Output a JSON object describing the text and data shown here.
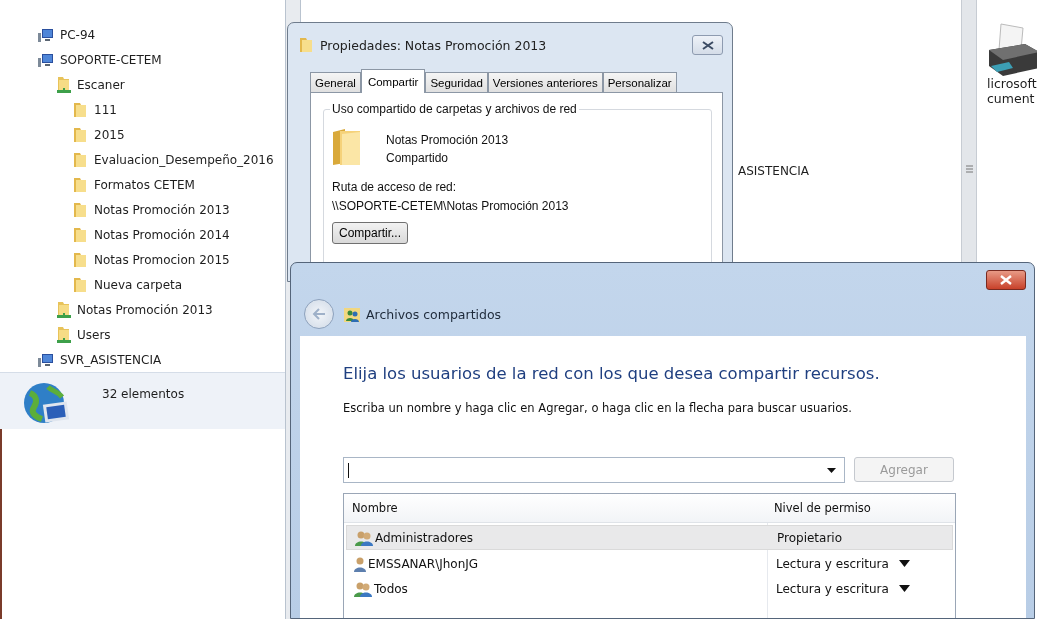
{
  "explorer": {
    "tree": [
      {
        "label": "PC-94",
        "kind": "computer"
      },
      {
        "label": "SOPORTE-CETEM",
        "kind": "computer",
        "children": [
          {
            "label": "Escaner",
            "kind": "share",
            "children": [
              {
                "label": "111",
                "kind": "folder"
              },
              {
                "label": "2015",
                "kind": "folder"
              },
              {
                "label": "Evaluacion_Desempeño_2016",
                "kind": "folder"
              },
              {
                "label": "Formatos CETEM",
                "kind": "folder"
              },
              {
                "label": "Notas Promoción 2013",
                "kind": "folder"
              },
              {
                "label": "Notas Promoción 2014",
                "kind": "folder"
              },
              {
                "label": "Notas Promocion 2015",
                "kind": "folder"
              },
              {
                "label": "Nueva carpeta",
                "kind": "folder"
              }
            ]
          },
          {
            "label": "Notas Promoción 2013",
            "kind": "share"
          },
          {
            "label": "Users",
            "kind": "share"
          }
        ]
      },
      {
        "label": "SVR_ASISTENCIA",
        "kind": "computer"
      }
    ],
    "details": {
      "count": "32 elementos"
    },
    "content_item": "ASISTENCIA",
    "right_pane": {
      "lines": [
        "licrosoft",
        "cument"
      ]
    }
  },
  "properties_dialog": {
    "title": "Propiedades: Notas Promoción 2013",
    "tabs": [
      {
        "label": "General",
        "selected": false
      },
      {
        "label": "Compartir",
        "selected": true
      },
      {
        "label": "Seguridad",
        "selected": false
      },
      {
        "label": "Versiones anteriores",
        "selected": false
      },
      {
        "label": "Personalizar",
        "selected": false
      }
    ],
    "group_title": "Uso compartido de carpetas y archivos de red",
    "folder_name": "Notas Promoción 2013",
    "folder_status": "Compartido",
    "path_label": "Ruta de acceso de red:",
    "path": "\\\\SOPORTE-CETEM\\Notas Promoción 2013",
    "share_button": "Compartir..."
  },
  "share_wizard": {
    "title": "Archivos compartidos",
    "heading": "Elija los usuarios de la red con los que desea compartir recursos.",
    "instruction": "Escriba un nombre y haga clic en Agregar, o haga clic en la flecha para buscar usuarios.",
    "add_button": {
      "label": "Agregar",
      "disabled": true
    },
    "table": {
      "columns": [
        "Nombre",
        "Nivel de permiso"
      ],
      "rows": [
        {
          "name": "Administradores",
          "kind": "group",
          "permission": "Propietario",
          "has_dropdown": false,
          "selected": true
        },
        {
          "name": "EMSSANAR\\JhonJG",
          "kind": "user",
          "permission": "Lectura y escritura",
          "has_dropdown": true,
          "selected": false
        },
        {
          "name": "Todos",
          "kind": "group",
          "permission": "Lectura y escritura",
          "has_dropdown": true,
          "selected": false
        }
      ]
    }
  }
}
